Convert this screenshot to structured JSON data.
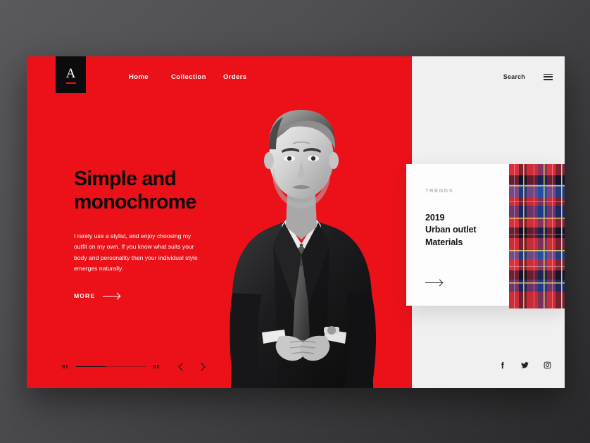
{
  "brand": {
    "logo_letter": "A"
  },
  "nav": {
    "items": [
      {
        "label": "Home"
      },
      {
        "label": "Collection"
      },
      {
        "label": "Orders"
      }
    ]
  },
  "hero": {
    "headline_line1": "Simple and",
    "headline_line2": "monochrome",
    "paragraph": "I rarely use a stylist, and enjoy choosing my outfit on my own. If you know what suits your body and personality then your individual style emerges naturally.",
    "cta_label": "MORE",
    "cta_icon": "arrow-right-icon",
    "background_color": "#ec1119",
    "headline_color": "#0b0b0b",
    "photo_alt": "man-in-suit-photo"
  },
  "slider": {
    "current": "01",
    "total": "02",
    "prev_icon": "chevron-left-icon",
    "next_icon": "chevron-right-icon",
    "progress_percent": 42
  },
  "side": {
    "search_label": "Search",
    "menu_icon": "hamburger-menu-icon",
    "background_color": "#f0f0f1",
    "card": {
      "kicker": "TRENDS",
      "title_line1": "2019",
      "title_line2": "Urban outlet",
      "title_line3": "Materials",
      "arrow_icon": "arrow-right-icon",
      "background_color": "#fdfdfd"
    },
    "swatch": {
      "name": "tartan-plaid-swatch",
      "colors": [
        "#e03038",
        "#c41f2c",
        "#1a2f7a",
        "#2a5fc4",
        "#121018",
        "#e8d46a"
      ]
    },
    "socials": [
      {
        "name": "facebook-icon"
      },
      {
        "name": "twitter-icon"
      },
      {
        "name": "instagram-icon"
      }
    ]
  },
  "canvas": {
    "background_start": "#5a5a5d",
    "background_end": "#2a2a2c"
  }
}
